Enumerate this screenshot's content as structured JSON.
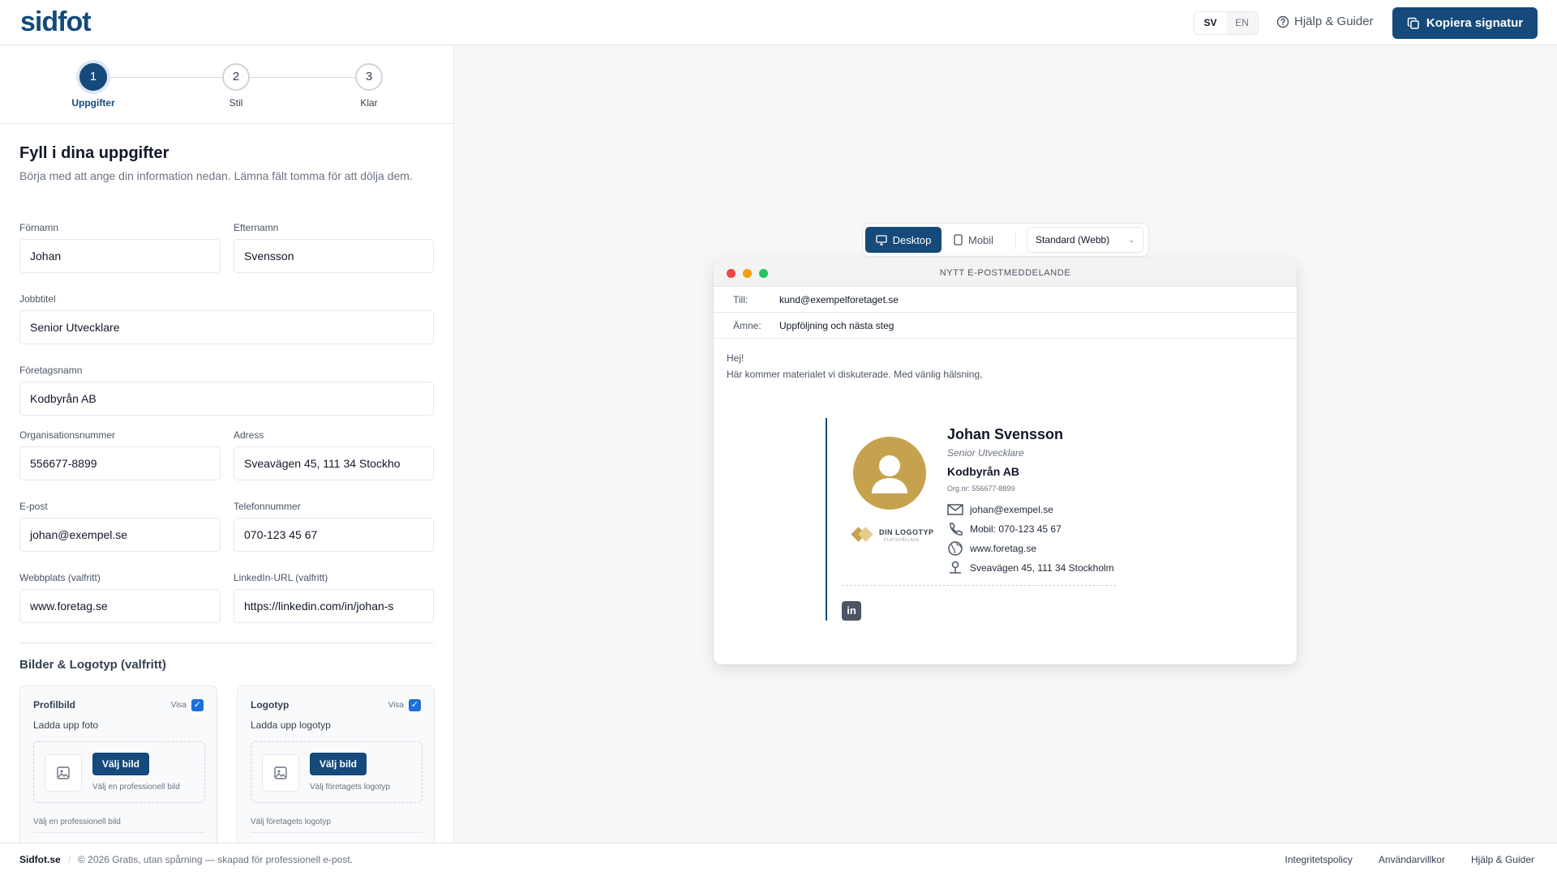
{
  "header": {
    "logo_text": "sidfot",
    "lang_sv": "SV",
    "lang_en": "EN",
    "help_label": "Hjälp & Guider",
    "copy_label": "Kopiera signatur"
  },
  "stepper": {
    "steps": [
      {
        "num": "1",
        "label": "Uppgifter"
      },
      {
        "num": "2",
        "label": "Stil"
      },
      {
        "num": "3",
        "label": "Klar"
      }
    ]
  },
  "form": {
    "title": "Fyll i dina uppgifter",
    "subtitle": "Börja med att ange din information nedan. Lämna fält tomma för att dölja dem.",
    "fields": {
      "first_name": {
        "label": "Förnamn",
        "value": "Johan"
      },
      "last_name": {
        "label": "Efternamn",
        "value": "Svensson"
      },
      "job_title": {
        "label": "Jobbtitel",
        "value": "Senior Utvecklare"
      },
      "company": {
        "label": "Företagsnamn",
        "value": "Kodbyrån AB"
      },
      "org_number": {
        "label": "Organisationsnummer",
        "value": "556677-8899"
      },
      "address": {
        "label": "Adress",
        "value": "Sveavägen 45, 111 34 Stockho"
      },
      "email": {
        "label": "E-post",
        "value": "johan@exempel.se"
      },
      "phone": {
        "label": "Telefonnummer",
        "value": "070-123 45 67"
      },
      "website": {
        "label": "Webbplats (valfritt)",
        "value": "www.foretag.se"
      },
      "linkedin": {
        "label": "LinkedIn-URL (valfritt)",
        "value": "https://linkedin.com/in/johan-s"
      }
    },
    "images_section": "Bilder & Logotyp (valfritt)",
    "cards": [
      {
        "title": "Profilbild",
        "show": "Visa",
        "upload": "Ladda upp foto",
        "button": "Välj bild",
        "hint": "Välj en professionell bild",
        "footer": "Välj en professionell bild"
      },
      {
        "title": "Logotyp",
        "show": "Visa",
        "upload": "Ladda upp logotyp",
        "button": "Välj bild",
        "hint": "Välj företagets logotyp",
        "footer": "Välj företagets logotyp"
      }
    ]
  },
  "preview": {
    "toolbar": {
      "desktop": "Desktop",
      "mobile": "Mobil",
      "select_value": "Standard (Webb)"
    },
    "mail": {
      "window_title": "NYTT E-POSTMEDDELANDE",
      "to_label": "Till:",
      "to_value": "kund@exempelforetaget.se",
      "subject_label": "Ämne:",
      "subject_value": "Uppföljning och nästa steg",
      "greeting": "Hej!",
      "body_line": "Här kommer materialet vi diskuterade. Med vänlig hälsning,"
    },
    "signature": {
      "name": "Johan Svensson",
      "title": "Senior Utvecklare",
      "company": "Kodbyrån AB",
      "org": "Org.nr: 556677-8899",
      "email": "johan@exempel.se",
      "phone": "Mobil: 070-123 45 67",
      "web": "www.foretag.se",
      "address": "Sveavägen 45, 111 34 Stockholm",
      "logo_text": "DIN LOGOTYP",
      "logo_sub": "PLATSHÅLLARE",
      "linkedin_glyph": "in"
    }
  },
  "footer": {
    "brand": "Sidfot.se",
    "divider": "/",
    "copyright": "© 2026 Gratis, utan spårning — skapad för professionell e-post.",
    "links": [
      "Integritetspolicy",
      "Användarvillkor",
      "Hjälp & Guider"
    ]
  },
  "colors": {
    "primary": "#154a7a",
    "accent_gold": "#c7a24e",
    "checkbox": "#1d6fd8"
  }
}
